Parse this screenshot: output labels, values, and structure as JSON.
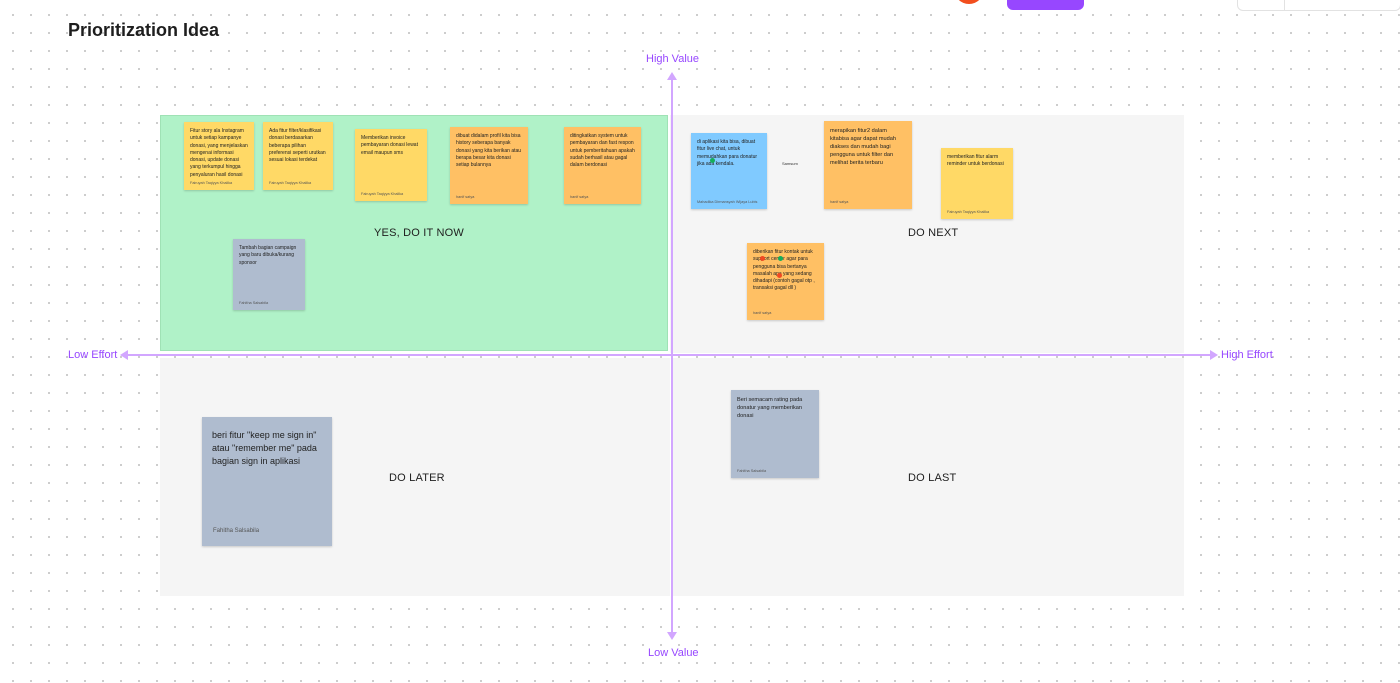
{
  "page": {
    "title": "Prioritization Idea"
  },
  "axes": {
    "top": "High Value",
    "bottom": "Low Value",
    "left": "Low Effort",
    "right": "High Effort"
  },
  "quadrants": {
    "top_left": "YES, DO IT NOW",
    "top_right": "DO NEXT",
    "bottom_left": "DO LATER",
    "bottom_right": "DO LAST"
  },
  "notes": [
    {
      "text": "Fitur story ala Instagram untuk setiap kampanye donasi, yang menjelaskan mengenai informasi donasi, update donasi yang terkumpul hingga penyaluran hasil donasi",
      "author": "Fairuyah Taqiyya Khalika",
      "color": "#ffd966"
    },
    {
      "text": "Ada fitur filter/klasifikasi donasi berdasarkan beberapa pilihan preferensi seperti urutkan sesuai lokasi terdekat",
      "author": "Fairuyah Taqiyya Khalika",
      "color": "#ffd966"
    },
    {
      "text": "Memberikan invoice pembayaran donasi lewat email maupun sms",
      "author": "Fairuyah Taqiyya Khalika",
      "color": "#ffd966"
    },
    {
      "text": "dibuat didalam profil kita bisa history seberapa banyak donasi yang kita berikan atau berapa besar kita donasi setiap bulannya",
      "author": "hanif satya",
      "color": "#ffc064"
    },
    {
      "text": "ditingkatkan system untuk pembayaran dan fast respon untuk pemberitahuan apakah sudah berhasil atau gagal dalam berdonasi",
      "author": "hanif satya",
      "color": "#ffc064"
    },
    {
      "text": "Tambah bagian campaign yang baru dibuka/kurang sponsor",
      "author": "Fahitha Salsabila",
      "color": "#afbccf"
    },
    {
      "text": "di aplikasi kita bisa, dibuat fitur live chat, untuk memudahkan para donatur jika ada kendala.",
      "author": "Mahadika Dirmansyah Wijaya Lubis",
      "color": "#80caff"
    },
    {
      "text": "merapikan fitur2 dalam kitabisa agar dapat mudah diakses dan mudah bagi pengguna untuk filter dan melihat berita terbaru",
      "author": "hanif satya",
      "color": "#ffc064"
    },
    {
      "text": "memberikan fitur alarm reminder untuk berdonasi",
      "author": "Fairuyah Taqiyya Khalika",
      "color": "#ffd966"
    },
    {
      "text": "diberikan fitur kontak untuk support center agar para pengguna bisa bertanya masalah apa yang sedang dihadapi (contoh gagal otp , transaksi gagal dll )",
      "author": "hanif satya",
      "color": "#ffc064"
    },
    {
      "text": "beri fitur \"keep me sign in\" atau \"remember me\" pada bagian sign in aplikasi",
      "author": "Fahitha Salsabila",
      "color": "#afbccf"
    },
    {
      "text": "Beri semacam rating pada donatur yang memberikan donasi",
      "author": "Fahitha Salsabila",
      "color": "#afbccf"
    }
  ],
  "stray_label": "Samsum"
}
